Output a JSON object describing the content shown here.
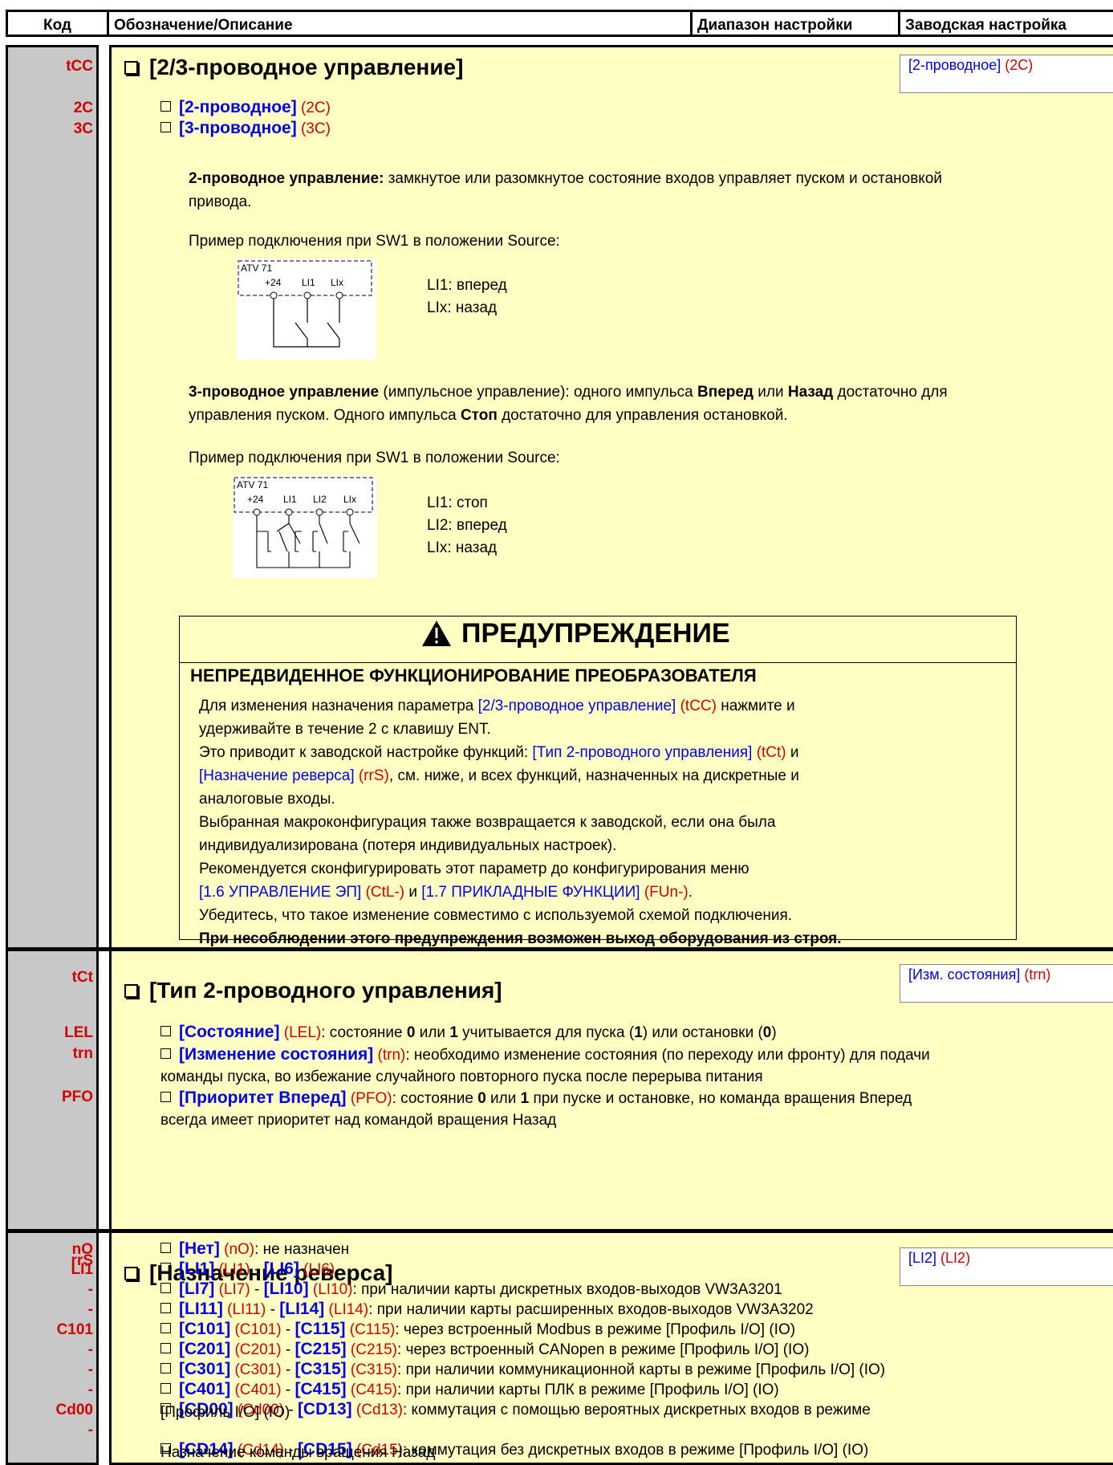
{
  "header": {
    "code": "Код",
    "desc": "Обозначение/Описание",
    "range": "Диапазон настройки",
    "factory": "Заводская настройка"
  },
  "tcc": {
    "code": "tCC",
    "title": "[2/3-проводное управление]",
    "factory_name": "[2-проводное]",
    "factory_code": "(2C)",
    "opt1_code": "2C",
    "opt1_name": "[2-проводное]",
    "opt1_abbr": "(2C)",
    "opt2_code": "3C",
    "opt2_name": "[3-проводное]",
    "opt2_abbr": "(3C)",
    "p2w_bold": "2-проводное управление:",
    "p2w_l1": " замкнутое или разомкнутое состояние входов управляет пуском и остановкой",
    "p2w_l2": "привода.",
    "example1": "Пример подключения при SW1 в положении Source:",
    "d1_l1": "LI1: вперед",
    "d1_l2": "LIx: назад",
    "p3w_bold": "3-проводное управление",
    "p3w_a": " (импульсное управление): одного импульса ",
    "p3w_fwd": "Вперед",
    "p3w_or": " или ",
    "p3w_rev": "Назад",
    "p3w_b": " достаточно для",
    "p3w_l2a": "управления пуском. Одного импульса ",
    "p3w_stop": "Стоп",
    "p3w_l2b": " достаточно для управления остановкой.",
    "example2": "Пример подключения при SW1 в положении Source:",
    "d2_l1": "LI1: стоп",
    "d2_l2": "LI2: вперед",
    "d2_l3": "LIx: назад",
    "diag": {
      "atv": "ATV 71",
      "p24": "+24",
      "li1": "LI1",
      "li2": "LI2",
      "lix": "LIx"
    }
  },
  "warning": {
    "title": "ПРЕДУПРЕЖДЕНИЕ",
    "subtitle": "НЕПРЕДВИДЕННОЕ ФУНКЦИОНИРОВАНИЕ ПРЕОБРАЗОВАТЕЛЯ",
    "l1a": "Для изменения назначения параметра ",
    "l1b": "[2/3-проводное управление]",
    "l1c": " (tCC)",
    "l1d": " нажмите и",
    "l2": "удерживайте в течение 2 с клавишу ENT.",
    "l3a": "Это приводит к заводской настройке функций: ",
    "l3b": "[Тип 2-проводного управления]",
    "l3c": " (tCt)",
    "l3d": " и",
    "l4a": "[Назначение реверса]",
    "l4b": " (rrS)",
    "l4c": ", см. ниже, и всех функций, назначенных на дискретные и",
    "l5": "аналоговые входы.",
    "l6": "Выбранная макроконфигурация также возвращается к заводской, если она была",
    "l7": "индивидуализирована (потеря индивидуальных настроек).",
    "l8": "Рекомендуется сконфигурировать этот параметр до конфигурирования меню",
    "l9a": "[1.6 УПРАВЛЕНИЕ ЭП]",
    "l9b": " (CtL-)",
    "l9c": " и ",
    "l9d": "[1.7 ПРИКЛАДНЫЕ ФУНКЦИИ]",
    "l9e": " (FUn-)",
    "l9f": ".",
    "l10": "Убедитесь, что такое изменение совместимо с используемой схемой подключения.",
    "l11": "При несоблюдении этого предупреждения возможен выход оборудования из строя."
  },
  "tct": {
    "code": "tCt",
    "title": "[Тип 2-проводного управления]",
    "factory_name": "[Изм. состояния]",
    "factory_code": "(trn)",
    "c1": "LEL",
    "c2": "trn",
    "c3": "PFO",
    "o1a": "[Состояние]",
    "o1b": " (LEL)",
    "o1c": ": состояние ",
    "o1d": "0",
    "o1e": " или ",
    "o1f": "1",
    "o1g": " учитывается для пуска (",
    "o1h": "1",
    "o1i": ") или остановки (",
    "o1j": "0",
    "o1k": ")",
    "o2a": "[Изменение состояния]",
    "o2b": " (trn)",
    "o2c": ": необходимо изменение состояния (по переходу или фронту) для подачи",
    "o2d": "команды пуска, во избежание случайного повторного пуска после перерыва питания",
    "o3a": "[Приоритет Вперед]",
    "o3b": " (PFO)",
    "o3c": ": состояние ",
    "o3d": "0",
    "o3e": " или ",
    "o3f": "1",
    "o3g": " при пуске и остановке, но команда вращения Вперед",
    "o3h": "всегда имеет приоритет над командой вращения Назад"
  },
  "rrs": {
    "code": "rrS",
    "title": "[Назначение реверса]",
    "factory_name": "[LI2]",
    "factory_code": "(LI2)",
    "codes": [
      "nO",
      "LI1",
      "-",
      "-",
      "C101",
      "-",
      "-",
      "-",
      "Cd00",
      "-"
    ],
    "items": [
      {
        "n1": "[Нет]",
        "c1": " (nO)",
        "rest": ": не назначен"
      },
      {
        "n1": "[LI1]",
        "c1": " (LI1)",
        "sep": " - ",
        "n2": "[LI6]",
        "c2": " (LI6)",
        "rest": ""
      },
      {
        "n1": "[LI7]",
        "c1": " (LI7)",
        "sep": " - ",
        "n2": "[LI10]",
        "c2": " (LI10)",
        "rest": ": при наличии карты дискретных входов-выходов VW3A3201"
      },
      {
        "n1": "[LI11]",
        "c1": " (LI11)",
        "sep": " - ",
        "n2": "[LI14]",
        "c2": " (LI14)",
        "rest": ": при наличии карты расширенных входов-выходов VW3A3202"
      },
      {
        "n1": "[C101]",
        "c1": " (C101)",
        "sep": " - ",
        "n2": "[C115]",
        "c2": " (C115)",
        "rest": ": через встроенный Modbus в режиме [Профиль I/O] (IO)"
      },
      {
        "n1": "[C201]",
        "c1": " (C201)",
        "sep": " - ",
        "n2": "[C215]",
        "c2": " (C215)",
        "rest": ": через встроенный CANopen в режиме [Профиль I/O] (IO)"
      },
      {
        "n1": "[C301]",
        "c1": " (C301)",
        "sep": " - ",
        "n2": "[C315]",
        "c2": " (C315)",
        "rest": ": при наличии коммуникационной карты в режиме [Профиль I/O] (IO)"
      },
      {
        "n1": "[C401]",
        "c1": " (C401)",
        "sep": " - ",
        "n2": "[C415]",
        "c2": " (C415)",
        "rest": ": при наличии карты ПЛК в режиме [Профиль I/O] (IO)"
      },
      {
        "n1": "[CD00]",
        "c1": " (Cd00)",
        "sep": " - ",
        "n2": "[CD13]",
        "c2": " (Cd13)",
        "rest": ": коммутация с помощью вероятных дискретных входов в режиме"
      },
      {
        "n1": "[CD14]",
        "c1": " (Cd14)",
        "sep": " - ",
        "n2": "[CD15]",
        "c2": " (Cd15)",
        "rest": ": коммутация без дискретных входов в режиме [Профиль I/O] (IO)"
      }
    ],
    "cont8": "[Профиль I/O] (IO)",
    "cont9": "Назначение команды вращения Назад"
  }
}
